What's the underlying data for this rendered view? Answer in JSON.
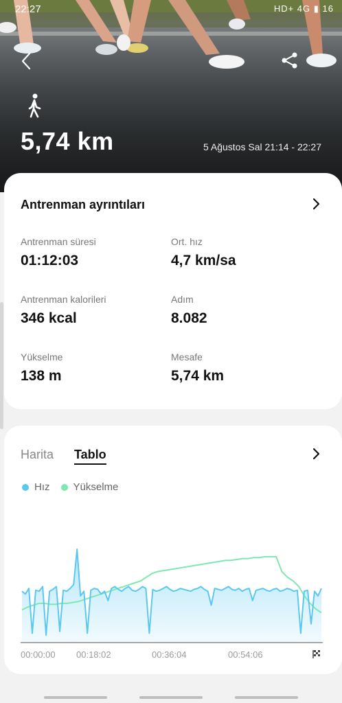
{
  "status_bar": {
    "time": "22:27",
    "right": "HD+ 4G ▮ 16"
  },
  "header": {
    "back_icon": "chevron-left-icon",
    "share_icon": "share-icon",
    "activity_icon": "walking-icon",
    "distance": "5,74 km",
    "date_range": "5 Ağustos Sal 21:14 - 22:27"
  },
  "details": {
    "title": "Antrenman ayrıntıları",
    "stats": [
      {
        "label": "Antrenman süresi",
        "value": "01:12:03"
      },
      {
        "label": "Ort. hız",
        "value": "4,7 km/sa"
      },
      {
        "label": "Antrenman kalorileri",
        "value": "346 kcal"
      },
      {
        "label": "Adım",
        "value": "8.082"
      },
      {
        "label": "Yükselme",
        "value": "138 m"
      },
      {
        "label": "Mesafe",
        "value": "5,74 km"
      }
    ]
  },
  "chart_card": {
    "tabs": [
      "Harita",
      "Tablo"
    ],
    "active_tab": "Tablo",
    "legend": [
      {
        "name": "Hız",
        "color": "#5ac8f0"
      },
      {
        "name": "Yükselme",
        "color": "#7de8b0"
      }
    ],
    "x_ticks": [
      "00:00:00",
      "00:18:02",
      "00:36:04",
      "00:54:06"
    ],
    "end_icon": "checkered-flag-icon"
  },
  "chart_data": {
    "type": "area",
    "x_ticks": [
      "00:00:00",
      "00:18:02",
      "00:36:04",
      "00:54:06"
    ],
    "series": [
      {
        "name": "Hız",
        "color": "#5ac8f0",
        "values": [
          0.55,
          0.52,
          0.58,
          0.1,
          0.56,
          0.55,
          0.6,
          0.08,
          0.55,
          0.57,
          0.6,
          0.12,
          0.56,
          0.55,
          0.58,
          0.62,
          1.0,
          0.5,
          0.55,
          0.1,
          0.56,
          0.58,
          0.57,
          0.52,
          0.55,
          0.45,
          0.58,
          0.6,
          0.57,
          0.55,
          0.58,
          0.6,
          0.56,
          0.55,
          0.57,
          0.6,
          0.58,
          0.1,
          0.57,
          0.55,
          0.56,
          0.58,
          0.6,
          0.57,
          0.55,
          0.56,
          0.58,
          0.57,
          0.56,
          0.55,
          0.57,
          0.58,
          0.6,
          0.57,
          0.55,
          0.4,
          0.58,
          0.57,
          0.56,
          0.58,
          0.6,
          0.57,
          0.56,
          0.58,
          0.55,
          0.57,
          0.58,
          0.45,
          0.56,
          0.57,
          0.58,
          0.56,
          0.55,
          0.57,
          0.58,
          0.55,
          0.56,
          0.58,
          0.57,
          0.55,
          0.56,
          0.1,
          0.55,
          0.56,
          0.2,
          0.55,
          0.5,
          0.58
        ]
      },
      {
        "name": "Yükselme",
        "color": "#7de8b0",
        "values": [
          0.35,
          0.38,
          0.4,
          0.42,
          0.42,
          0.41,
          0.41,
          0.42,
          0.42,
          0.43,
          0.44,
          0.46,
          0.48,
          0.5,
          0.52,
          0.54,
          0.56,
          0.58,
          0.6,
          0.62,
          0.64,
          0.66,
          0.7,
          0.74,
          0.76,
          0.77,
          0.78,
          0.79,
          0.8,
          0.81,
          0.82,
          0.83,
          0.84,
          0.85,
          0.86,
          0.87,
          0.88,
          0.88,
          0.89,
          0.9,
          0.9,
          0.91,
          0.91,
          0.92,
          0.92,
          0.92,
          0.76,
          0.7,
          0.66,
          0.6,
          0.5,
          0.42,
          0.36,
          0.32
        ]
      }
    ]
  }
}
